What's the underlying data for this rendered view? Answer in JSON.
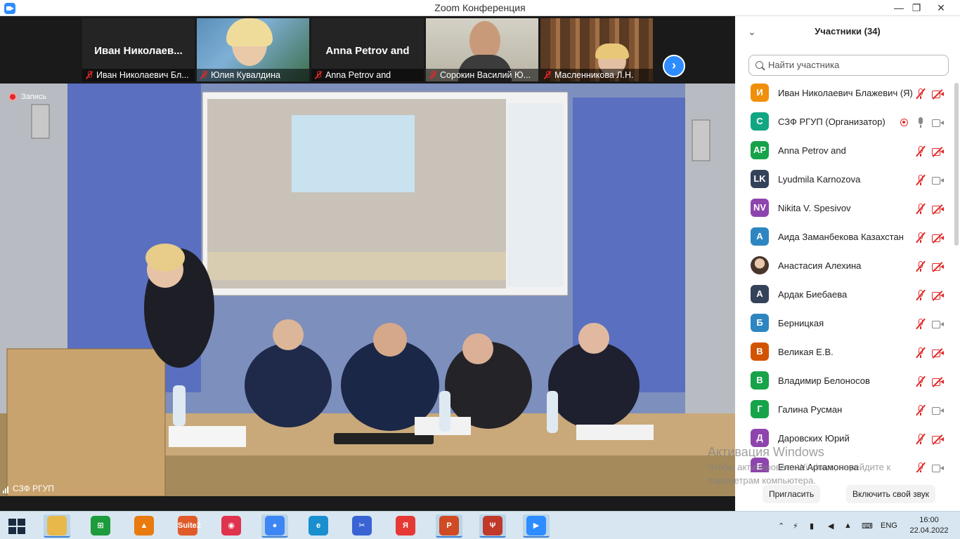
{
  "window": {
    "title": "Zoom Конференция",
    "minimize_glyph": "—",
    "maximize_glyph": "❐",
    "close_glyph": "✕"
  },
  "gallery": {
    "tiles": [
      {
        "big_name": "Иван  Николаев...",
        "label": "Иван Николаевич Бл..."
      },
      {
        "big_name": "",
        "label": "Юлия Кувалдина"
      },
      {
        "big_name": "Anna Petrov and",
        "label": "Anna Petrov and"
      },
      {
        "big_name": "",
        "label": "Сорокин Василий Ю..."
      },
      {
        "big_name": "",
        "label": "Масленникова Л.Н."
      }
    ],
    "next_glyph": "›"
  },
  "main_video": {
    "recording_label": "Запись",
    "host_label": "СЗФ РГУП"
  },
  "participants": {
    "collapse_glyph": "⌄",
    "title": "Участники (34)",
    "search_placeholder": "Найти участника",
    "list": [
      {
        "initials": "И",
        "color": "#f0900a",
        "name": "Иван Николаевич Блажевич (Я)",
        "mic": "off",
        "cam": "off",
        "rec": false
      },
      {
        "initials": "С",
        "color": "#11a683",
        "name": "СЗФ РГУП (Организатор)",
        "mic": "on",
        "cam": "on",
        "rec": true
      },
      {
        "initials": "AP",
        "color": "#16a34a",
        "name": "Anna Petrov and",
        "mic": "off",
        "cam": "off",
        "rec": false
      },
      {
        "initials": "LK",
        "color": "#34425a",
        "name": "Lyudmila Karnozova",
        "mic": "off",
        "cam": "on",
        "rec": false
      },
      {
        "initials": "NV",
        "color": "#8e44ad",
        "name": "Nikita V. Spesivov",
        "mic": "off",
        "cam": "off",
        "rec": false
      },
      {
        "initials": "А",
        "color": "#2e86c1",
        "name": "Аида Заманбекова Казахстан",
        "mic": "off",
        "cam": "off",
        "rec": false
      },
      {
        "initials": "",
        "color": "#5a4a42",
        "name": "Анастасия Алехина",
        "mic": "off",
        "cam": "off",
        "rec": false
      },
      {
        "initials": "А",
        "color": "#34425a",
        "name": "Ардак Биебаева",
        "mic": "off",
        "cam": "off",
        "rec": false
      },
      {
        "initials": "Б",
        "color": "#2e86c1",
        "name": "Берницкая",
        "mic": "off",
        "cam": "on",
        "rec": false
      },
      {
        "initials": "В",
        "color": "#d35400",
        "name": "Великая Е.В.",
        "mic": "off",
        "cam": "off",
        "rec": false
      },
      {
        "initials": "В",
        "color": "#16a34a",
        "name": "Владимир Белоносов",
        "mic": "off",
        "cam": "off",
        "rec": false
      },
      {
        "initials": "Г",
        "color": "#16a34a",
        "name": "Галина Русман",
        "mic": "off",
        "cam": "on",
        "rec": false
      },
      {
        "initials": "Д",
        "color": "#8e44ad",
        "name": "Даровских Юрий",
        "mic": "off",
        "cam": "off",
        "rec": false
      },
      {
        "initials": "Е",
        "color": "#8e44ad",
        "name": "Елена Артамонова",
        "mic": "off",
        "cam": "on",
        "rec": false
      }
    ],
    "invite_label": "Пригласить",
    "unmute_label": "Включить свой звук"
  },
  "watermark": {
    "line1": "Активация Windows",
    "line2": "Чтобы активировать Windows, перейдите к",
    "line3": "параметрам компьютера."
  },
  "taskbar": {
    "apps": [
      {
        "name": "file-explorer-icon",
        "glyph": "",
        "color": "#e8b84a",
        "active": true
      },
      {
        "name": "store-icon",
        "glyph": "⊞",
        "color": "#1e9b3c",
        "active": false
      },
      {
        "name": "aimp-icon",
        "glyph": "▲",
        "color": "#e87a0e",
        "active": false
      },
      {
        "name": "suite-icon",
        "glyph": "Suite2",
        "color": "#e05a2a",
        "active": false
      },
      {
        "name": "pdf-viewer-icon",
        "glyph": "◉",
        "color": "#e0334d",
        "active": false
      },
      {
        "name": "chrome-icon",
        "glyph": "●",
        "color": "#3e86f5",
        "active": true
      },
      {
        "name": "edge-icon",
        "glyph": "e",
        "color": "#1a8fd0",
        "active": false
      },
      {
        "name": "snipping-tool-icon",
        "glyph": "✂",
        "color": "#3a64d4",
        "active": false
      },
      {
        "name": "yandex-browser-icon",
        "glyph": "Я",
        "color": "#e53935",
        "active": false
      },
      {
        "name": "powerpoint-icon",
        "glyph": "P",
        "color": "#d04a23",
        "active": true
      },
      {
        "name": "reader-icon",
        "glyph": "Ψ",
        "color": "#c0392b",
        "active": true
      },
      {
        "name": "zoom-icon",
        "glyph": "▶",
        "color": "#2d8cff",
        "active": true
      }
    ],
    "tray": {
      "language": "ENG",
      "time": "16:00",
      "date": "22.04.2022"
    }
  }
}
